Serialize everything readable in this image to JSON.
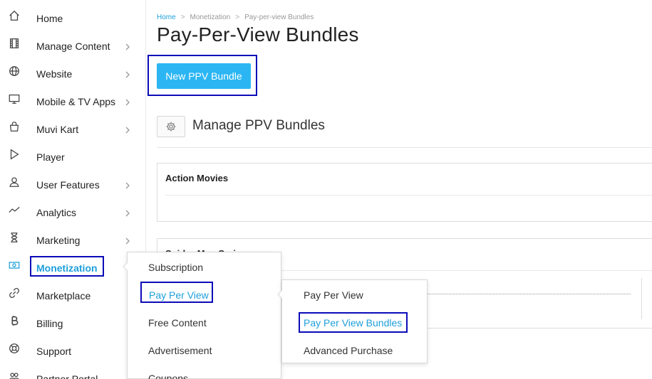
{
  "sidebar": {
    "items": [
      {
        "label": "Home",
        "icon": "home-icon",
        "chevron": false
      },
      {
        "label": "Manage Content",
        "icon": "film-icon",
        "chevron": true
      },
      {
        "label": "Website",
        "icon": "globe-icon",
        "chevron": true
      },
      {
        "label": "Mobile & TV Apps",
        "icon": "monitor-icon",
        "chevron": true
      },
      {
        "label": "Muvi Kart",
        "icon": "shopping-bag-icon",
        "chevron": true
      },
      {
        "label": "Player",
        "icon": "play-icon",
        "chevron": false
      },
      {
        "label": "User Features",
        "icon": "user-icon",
        "chevron": true
      },
      {
        "label": "Analytics",
        "icon": "trend-icon",
        "chevron": true
      },
      {
        "label": "Marketing",
        "icon": "hourglass-icon",
        "chevron": true
      },
      {
        "label": "Monetization",
        "icon": "money-icon",
        "chevron": false,
        "active": true
      },
      {
        "label": "Marketplace",
        "icon": "link-icon",
        "chevron": false
      },
      {
        "label": "Billing",
        "icon": "bitcoin-icon",
        "chevron": false
      },
      {
        "label": "Support",
        "icon": "lifebuoy-icon",
        "chevron": false
      },
      {
        "label": "Partner Portal",
        "icon": "partner-icon",
        "chevron": false
      }
    ]
  },
  "breadcrumb": {
    "home": "Home",
    "sep": ">",
    "level1": "Monetization",
    "level2": "Pay-per-view Bundles"
  },
  "page": {
    "title": "Pay-Per-View Bundles",
    "new_button": "New PPV Bundle",
    "section_title": "Manage PPV Bundles"
  },
  "cards": [
    {
      "title": "Action Movies"
    },
    {
      "title": "Spider-Man Series"
    }
  ],
  "monetization_menu": {
    "items": [
      {
        "label": "Subscription"
      },
      {
        "label": "Pay Per View",
        "active": true
      },
      {
        "label": "Free Content"
      },
      {
        "label": "Advertisement"
      },
      {
        "label": "Coupons"
      }
    ]
  },
  "ppv_menu": {
    "items": [
      {
        "label": "Pay Per View"
      },
      {
        "label": "Pay Per View Bundles",
        "active": true
      },
      {
        "label": "Advanced Purchase"
      }
    ]
  },
  "colors": {
    "accent": "#1e9fdb",
    "button": "#2bb6f3",
    "highlight_box": "#0b0bb8"
  }
}
